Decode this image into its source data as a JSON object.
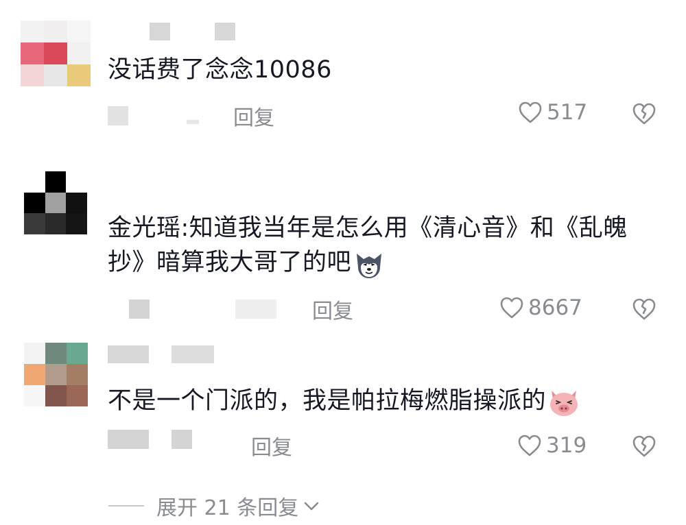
{
  "comments": [
    {
      "text": "没话费了念念10086",
      "reply_label": "回复",
      "likes": "517",
      "avatar_colors": [
        "#f2f2f2",
        "#f0eeee",
        "#f5f5f5",
        "#e8677b",
        "#d9495a",
        "#f1f1f1",
        "#f3d5d8",
        "#e6e6e6",
        "#e9c97a"
      ]
    },
    {
      "text": "金光瑶:知道我当年是怎么用《清心音》和《乱魄抄》暗算我大哥了的吧",
      "emoji": "wolf-emoji",
      "reply_label": "回复",
      "likes": "8667",
      "avatar_colors": [
        "#ffffff",
        "#000000",
        "#ffffff",
        "#000000",
        "#a0a0a0",
        "#111111",
        "#3a3a3a",
        "#2a2a2a",
        "#151515"
      ]
    },
    {
      "text": "不是一个门派的，我是帕拉梅燃脂操派的",
      "emoji": "pig-face-emoji",
      "reply_label": "回复",
      "likes": "319",
      "avatar_colors": [
        "#f3f3f3",
        "#6f8a7d",
        "#6aa892",
        "#f1a772",
        "#b09b8c",
        "#a47d65",
        "#f6f6f6",
        "#82564d",
        "#9b6757"
      ]
    }
  ],
  "expand_label": "展开 21 条回复",
  "colors": {
    "text_primary": "#161823",
    "text_secondary": "#8a8b91",
    "placeholder_block": "#d7d7d7"
  }
}
